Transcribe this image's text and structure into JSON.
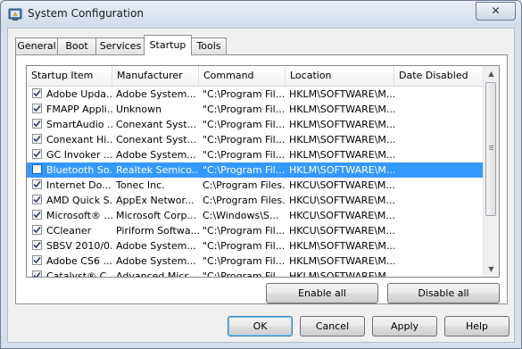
{
  "window": {
    "title": "System Configuration",
    "close_glyph": "✕",
    "title_icon": "msconfig-icon"
  },
  "tabs": [
    {
      "label": "General"
    },
    {
      "label": "Boot"
    },
    {
      "label": "Services"
    },
    {
      "label": "Startup"
    },
    {
      "label": "Tools"
    }
  ],
  "active_tab": "Startup",
  "columns": [
    {
      "label": "Startup Item"
    },
    {
      "label": "Manufacturer"
    },
    {
      "label": "Command"
    },
    {
      "label": "Location"
    },
    {
      "label": "Date Disabled"
    }
  ],
  "rows": [
    {
      "checked": true,
      "item": "Adobe Upda...",
      "manufacturer": "Adobe System...",
      "command": "\"C:\\Program Fil...",
      "location": "HKLM\\SOFTWARE\\M...",
      "date_disabled": ""
    },
    {
      "checked": true,
      "item": "FMAPP Appli...",
      "manufacturer": "Unknown",
      "command": "\"C:\\Program Fil...",
      "location": "HKLM\\SOFTWARE\\M...",
      "date_disabled": ""
    },
    {
      "checked": true,
      "item": "SmartAudio ...",
      "manufacturer": "Conexant Syst...",
      "command": "\"C:\\Program Fil...",
      "location": "HKLM\\SOFTWARE\\M...",
      "date_disabled": ""
    },
    {
      "checked": true,
      "item": "Conexant Hi...",
      "manufacturer": "Conexant Syst...",
      "command": "\"C:\\Program Fil...",
      "location": "HKLM\\SOFTWARE\\M...",
      "date_disabled": ""
    },
    {
      "checked": true,
      "item": "GC Invoker ...",
      "manufacturer": "Adobe System...",
      "command": "\"C:\\Program Fil...",
      "location": "HKLM\\SOFTWARE\\M...",
      "date_disabled": ""
    },
    {
      "checked": false,
      "item": "Bluetooth So...",
      "manufacturer": "Realtek Semico...",
      "command": "\"C:\\Program Fil...",
      "location": "HKLM\\SOFTWARE\\M...",
      "date_disabled": "",
      "selected": true
    },
    {
      "checked": true,
      "item": "Internet Do...",
      "manufacturer": "Tonec Inc.",
      "command": "C:\\Program Files...",
      "location": "HKCU\\SOFTWARE\\M...",
      "date_disabled": ""
    },
    {
      "checked": true,
      "item": "AMD Quick S...",
      "manufacturer": "AppEx Networ...",
      "command": "C:\\Program Files...",
      "location": "HKCU\\SOFTWARE\\M...",
      "date_disabled": ""
    },
    {
      "checked": true,
      "item": "Microsoft® ...",
      "manufacturer": "Microsoft Corp...",
      "command": "C:\\Windows\\S...",
      "location": "HKCU\\SOFTWARE\\M...",
      "date_disabled": ""
    },
    {
      "checked": true,
      "item": "CCleaner",
      "manufacturer": "Piriform Softwa...",
      "command": "\"C:\\Program Fil...",
      "location": "HKCU\\SOFTWARE\\M...",
      "date_disabled": ""
    },
    {
      "checked": true,
      "item": "SBSV 2010/0...",
      "manufacturer": "Adobe System...",
      "command": "\"C:\\Program Fil...",
      "location": "HKLM\\SOFTWARE\\M...",
      "date_disabled": ""
    },
    {
      "checked": true,
      "item": "Adobe CS6 ...",
      "manufacturer": "Adobe System...",
      "command": "\"C:\\Program Fil...",
      "location": "HKLM\\SOFTWARE\\M...",
      "date_disabled": ""
    },
    {
      "checked": true,
      "item": "Catalyst® C...",
      "manufacturer": "Advanced Micr...",
      "command": "\"C:\\Program Fil...",
      "location": "HKLM\\SOFTWARE\\M...",
      "date_disabled": ""
    }
  ],
  "panel_buttons": {
    "enable_all": "Enable all",
    "disable_all": "Disable all"
  },
  "footer_buttons": {
    "ok": "OK",
    "cancel": "Cancel",
    "apply": "Apply",
    "help": "Help"
  },
  "scrollbar": {
    "up_glyph": "▲",
    "down_glyph": "▼"
  }
}
